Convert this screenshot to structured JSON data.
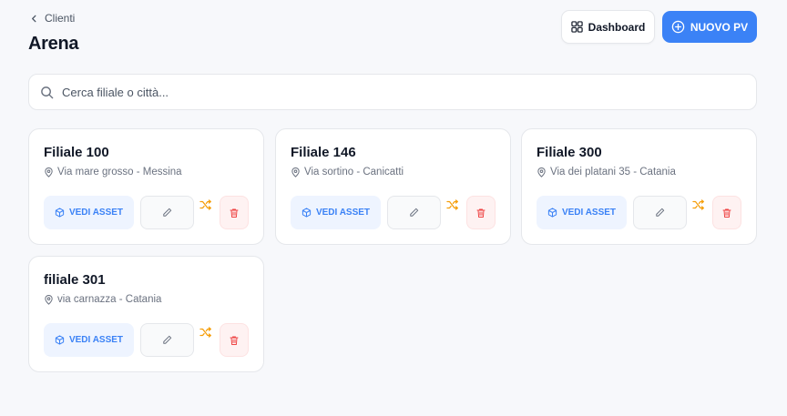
{
  "header": {
    "back_label": "Clienti",
    "title": "Arena",
    "dashboard_label": "Dashboard",
    "new_label": "NUOVO PV"
  },
  "search": {
    "placeholder": "Cerca filiale o città...",
    "value": ""
  },
  "cards": [
    {
      "name": "Filiale 100",
      "address": "Via mare grosso - Messina",
      "assets_label": "VEDI ASSET"
    },
    {
      "name": "Filiale 146",
      "address": "Via sortino - Canicatti",
      "assets_label": "VEDI ASSET"
    },
    {
      "name": "Filiale 300",
      "address": "Via dei platani 35 - Catania",
      "assets_label": "VEDI ASSET"
    },
    {
      "name": "filiale 301",
      "address": "via carnazza - Catania",
      "assets_label": "VEDI ASSET"
    }
  ],
  "colors": {
    "accent": "#3b82f6",
    "shuffle": "#f59e0b",
    "danger": "#ef4444",
    "background": "#f7f8fb"
  },
  "icons": {
    "back": "chevron-left-icon",
    "dashboard": "grid-icon",
    "new": "plus-circle-icon",
    "search": "search-icon",
    "address": "map-pin-icon",
    "assets": "cube-icon",
    "edit": "pencil-icon",
    "shuffle": "shuffle-icon",
    "delete": "trash-icon"
  }
}
